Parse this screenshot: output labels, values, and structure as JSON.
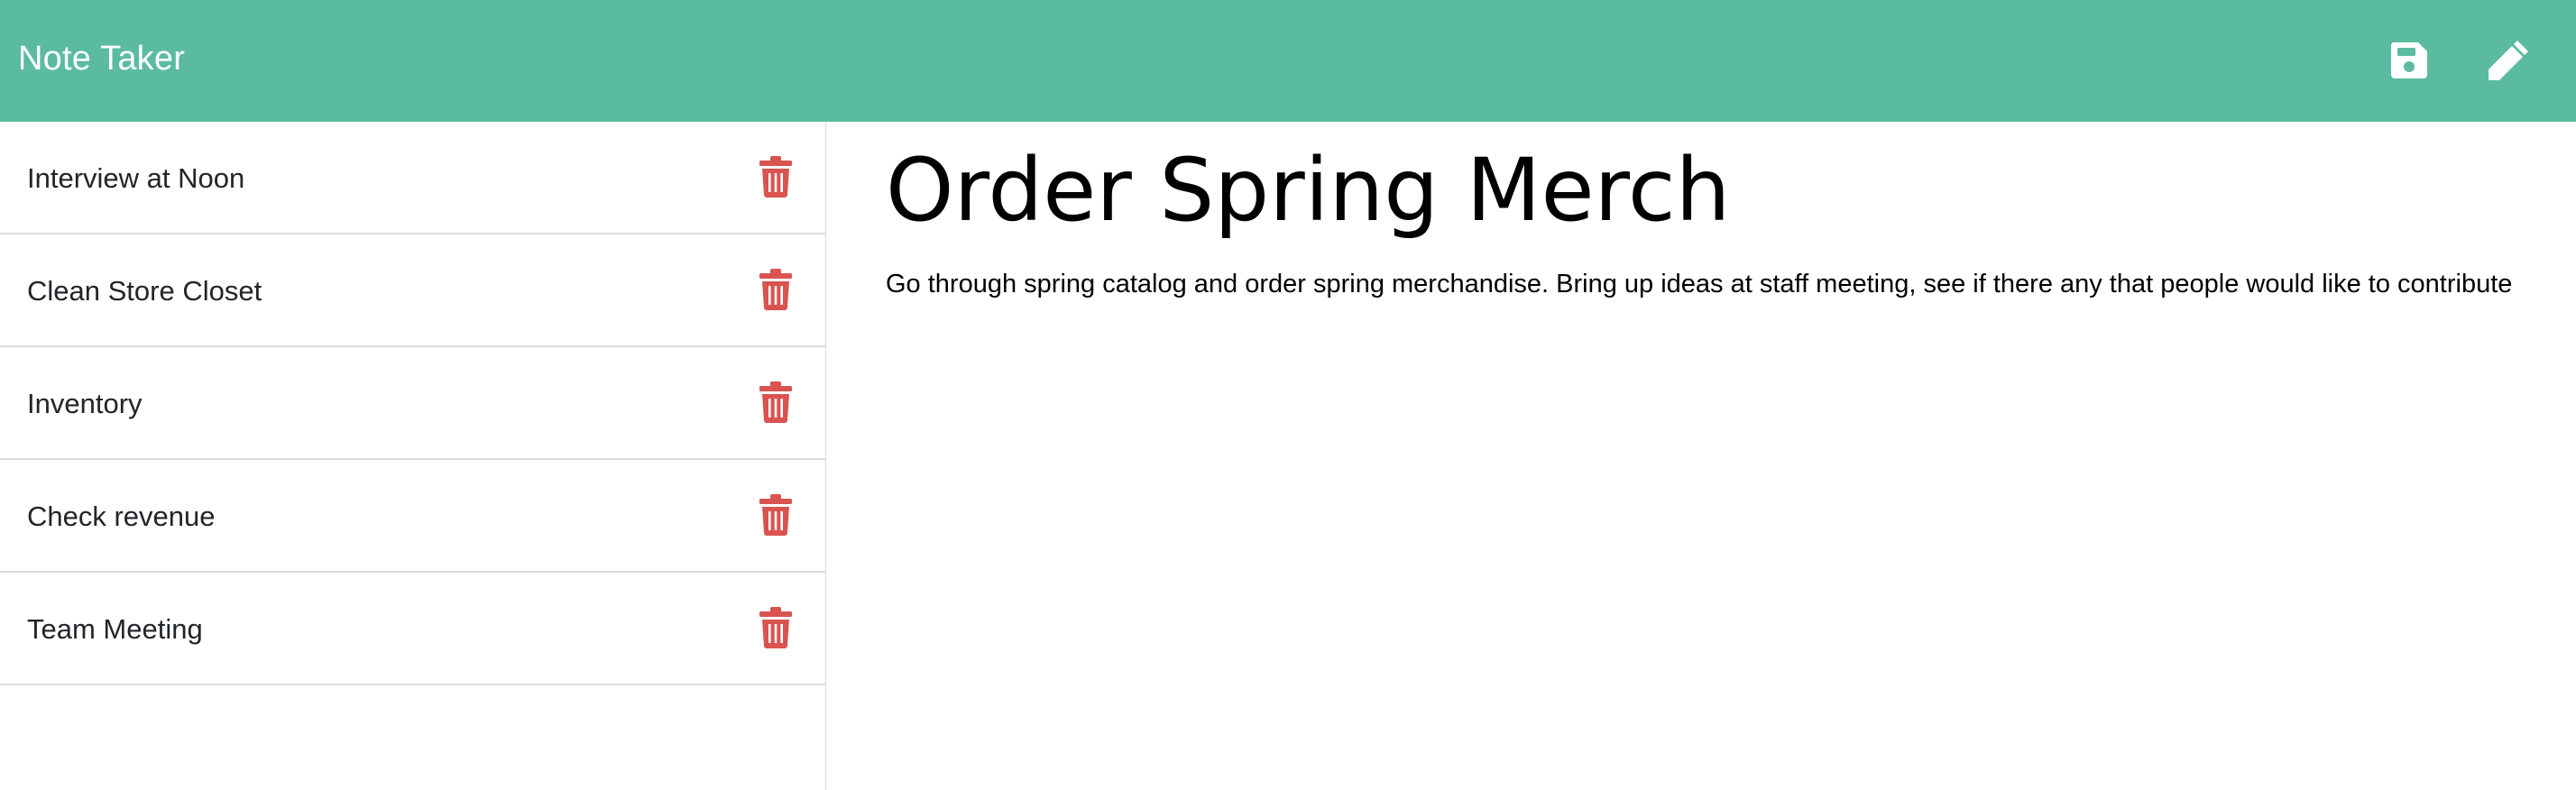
{
  "navbar": {
    "brand": "Note Taker",
    "background_color": "#5bbba0",
    "save_icon": "floppy-disk-icon",
    "new_icon": "pencil-icon"
  },
  "sidebar": {
    "items": [
      {
        "label": "Interview at Noon"
      },
      {
        "label": "Clean Store Closet"
      },
      {
        "label": "Inventory"
      },
      {
        "label": "Check revenue"
      },
      {
        "label": "Team Meeting"
      }
    ],
    "delete_icon": "trash-icon",
    "delete_icon_color": "#d9534f"
  },
  "note": {
    "title": "Order Spring Merch",
    "text": "Go through spring catalog and order spring merchandise. Bring up ideas at staff meeting, see if there any that people would like to contribute"
  }
}
